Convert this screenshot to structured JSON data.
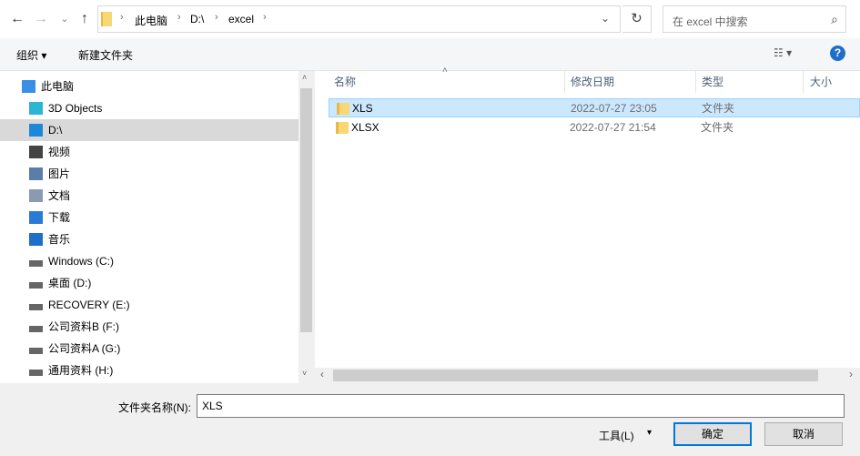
{
  "nav": {
    "back": "←",
    "forward": "→",
    "recent": "⌄",
    "up": "↑",
    "breadcrumb": [
      "此电脑",
      "D:\\",
      "excel"
    ],
    "refresh": "↻",
    "search_placeholder": "在 excel 中搜索",
    "search_icon": "⌕"
  },
  "toolbar": {
    "organize": "组织 ▾",
    "new_folder": "新建文件夹",
    "view": "☷ ▾",
    "help": "?"
  },
  "sidebar": {
    "items": [
      {
        "label": "此电脑",
        "icon": "computer-icon"
      },
      {
        "label": "3D Objects",
        "icon": "cube-icon"
      },
      {
        "label": "D:\\",
        "icon": "drive-icon"
      },
      {
        "label": "视频",
        "icon": "video-icon"
      },
      {
        "label": "图片",
        "icon": "picture-icon"
      },
      {
        "label": "文档",
        "icon": "document-icon"
      },
      {
        "label": "下载",
        "icon": "download-icon"
      },
      {
        "label": "音乐",
        "icon": "music-icon"
      },
      {
        "label": "Windows (C:)",
        "icon": "drive-icon"
      },
      {
        "label": "桌面 (D:)",
        "icon": "drive-icon"
      },
      {
        "label": "RECOVERY (E:)",
        "icon": "drive-icon"
      },
      {
        "label": "公司资料B (F:)",
        "icon": "drive-icon"
      },
      {
        "label": "公司资料A (G:)",
        "icon": "drive-icon"
      },
      {
        "label": "通用资料 (H:)",
        "icon": "drive-icon"
      }
    ]
  },
  "columns": [
    "名称",
    "修改日期",
    "类型",
    "大小"
  ],
  "files": [
    {
      "name": "XLS",
      "date": "2022-07-27 23:05",
      "type": "文件夹"
    },
    {
      "name": "XLSX",
      "date": "2022-07-27 21:54",
      "type": "文件夹"
    }
  ],
  "footer": {
    "folder_name_label": "文件夹名称(N):",
    "folder_name_value": "XLS",
    "tools": "工具(L)",
    "tools_arrow": "▾",
    "ok": "确定",
    "cancel": "取消"
  }
}
